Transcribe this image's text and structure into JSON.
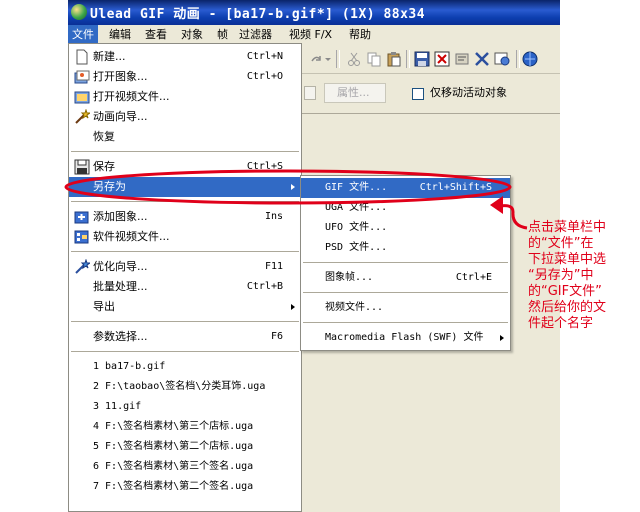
{
  "window": {
    "title": "Ulead GIF 动画 - [ba17-b.gif*] (1X) 88x34",
    "menubar": [
      "文件",
      "编辑",
      "查看",
      "对象",
      "帧",
      "过滤器",
      "视频 F/X",
      "帮助"
    ],
    "toolbar2": {
      "properties_label": "属性...",
      "move_only_label": "仅移动活动对象"
    }
  },
  "file_menu": {
    "items": [
      {
        "label": "新建...",
        "shortcut": "Ctrl+N"
      },
      {
        "label": "打开图象...",
        "shortcut": "Ctrl+O"
      },
      {
        "label": "打开视频文件...",
        "shortcut": ""
      },
      {
        "label": "动画向导...",
        "shortcut": ""
      },
      {
        "label": "恢复",
        "shortcut": ""
      },
      {
        "label": "保存",
        "shortcut": "Ctrl+S"
      },
      {
        "label": "另存为",
        "shortcut": ""
      },
      {
        "label": "添加图象...",
        "shortcut": "Ins"
      },
      {
        "label": "软件视频文件...",
        "shortcut": ""
      },
      {
        "label": "优化向导...",
        "shortcut": "F11"
      },
      {
        "label": "批量处理...",
        "shortcut": "Ctrl+B"
      },
      {
        "label": "导出",
        "shortcut": ""
      },
      {
        "label": "参数选择...",
        "shortcut": "F6"
      }
    ],
    "recent": [
      "1 ba17-b.gif",
      "2 F:\\taobao\\签名档\\分类耳饰.uga",
      "3 11.gif",
      "4 F:\\签名档素材\\第三个店标.uga",
      "5 F:\\签名档素材\\第二个店标.uga",
      "6 F:\\签名档素材\\第三个签名.uga",
      "7 F:\\签名档素材\\第二个签名.uga"
    ]
  },
  "save_as_submenu": {
    "items": [
      {
        "label": "GIF 文件...",
        "shortcut": "Ctrl+Shift+S"
      },
      {
        "label": "UGA 文件...",
        "shortcut": ""
      },
      {
        "label": "UFO 文件...",
        "shortcut": ""
      },
      {
        "label": "PSD 文件...",
        "shortcut": ""
      },
      {
        "label": "图象帧...",
        "shortcut": "Ctrl+E"
      },
      {
        "label": "视频文件...",
        "shortcut": ""
      },
      {
        "label": "Macromedia Flash (SWF) 文件",
        "shortcut": ""
      }
    ]
  },
  "annotation": {
    "lines": [
      "点击菜单栏中",
      "的“文件”在",
      "下拉菜单中选",
      "“另存为”中",
      "的“GIF文件”",
      "然后给你的文",
      "件起个名字"
    ],
    "color": "#e0001a"
  },
  "colors": {
    "highlight": "#316ac5",
    "titlebar": "#0a246a",
    "window_bg": "#ece9d8"
  }
}
